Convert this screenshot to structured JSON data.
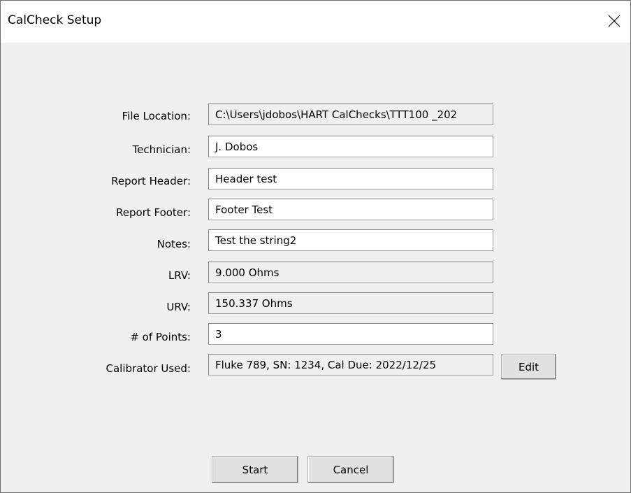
{
  "window": {
    "title": "CalCheck Setup"
  },
  "form": {
    "file_location": {
      "label": "File Location:",
      "value": "C:\\Users\\jdobos\\HART CalChecks\\TTT100  _202"
    },
    "technician": {
      "label": "Technician:",
      "value": "J. Dobos"
    },
    "report_header": {
      "label": "Report Header:",
      "value": "Header test"
    },
    "report_footer": {
      "label": "Report Footer:",
      "value": "Footer Test"
    },
    "notes": {
      "label": "Notes:",
      "value": "Test the string2"
    },
    "lrv": {
      "label": "LRV:",
      "value": "9.000 Ohms"
    },
    "urv": {
      "label": "URV:",
      "value": "150.337 Ohms"
    },
    "num_points": {
      "label": "# of Points:",
      "value": "3"
    },
    "calibrator": {
      "label": "Calibrator Used:",
      "value": "Fluke 789, SN: 1234, Cal Due: 2022/12/25"
    }
  },
  "buttons": {
    "edit": "Edit",
    "start": "Start",
    "cancel": "Cancel"
  },
  "icons": {
    "close": "close-icon"
  }
}
